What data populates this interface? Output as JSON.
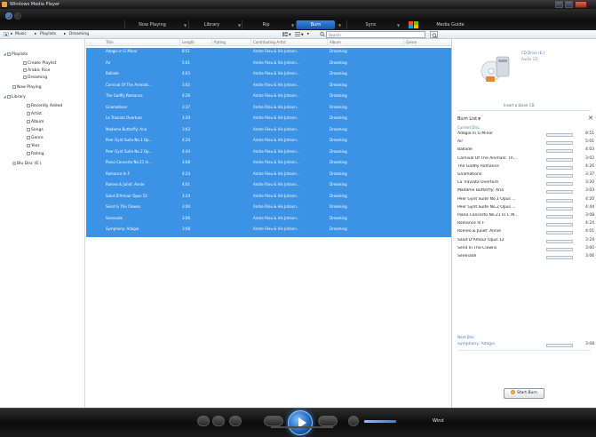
{
  "window": {
    "title": "Windows Media Player"
  },
  "nav": {
    "tabs": [
      {
        "label": "Now Playing"
      },
      {
        "label": "Library"
      },
      {
        "label": "Rip"
      },
      {
        "label": "Burn"
      },
      {
        "label": "Sync"
      },
      {
        "label": "Media Guide"
      }
    ],
    "active_tab": "Burn"
  },
  "address": {
    "breadcrumb": [
      "Music",
      "Playlists",
      "Dreaming"
    ],
    "search_placeholder": "Search"
  },
  "sidebar": {
    "items": [
      {
        "label": "Playlists",
        "level": 0,
        "expanded": true
      },
      {
        "label": "Create Playlist",
        "level": 1
      },
      {
        "label": "Arabic Rice",
        "level": 1
      },
      {
        "label": "Dreaming",
        "level": 1
      },
      {
        "label": "Now Playing",
        "level": 0
      },
      {
        "label": "Library",
        "level": 0,
        "expanded": true
      },
      {
        "label": "Recently Added",
        "level": 1
      },
      {
        "label": "Artist",
        "level": 1
      },
      {
        "label": "Album",
        "level": 1
      },
      {
        "label": "Songs",
        "level": 1
      },
      {
        "label": "Genre",
        "level": 1
      },
      {
        "label": "Year",
        "level": 1
      },
      {
        "label": "Rating",
        "level": 1
      },
      {
        "label": "Blu Disc (E:)",
        "level": 0
      }
    ]
  },
  "tracklist": {
    "columns": [
      "Title",
      "Length",
      "Rating",
      "Contributing Artist",
      "Album",
      "Genre"
    ],
    "rows": [
      {
        "title": "Adagio In G Minor",
        "length": "8:51",
        "rating": 3,
        "artist": "Andre Rieu & His Johann...",
        "album": "Dreaming"
      },
      {
        "title": "Air",
        "length": "5:01",
        "rating": 3,
        "artist": "Andre Rieu & His Johann...",
        "album": "Dreaming"
      },
      {
        "title": "Ballade",
        "length": "4:03",
        "rating": 3,
        "artist": "Andre Rieu & His Johann...",
        "album": "Dreaming"
      },
      {
        "title": "Carnival Of The Animals...",
        "length": "3:02",
        "rating": 3,
        "artist": "Andre Rieu & His Johann...",
        "album": "Dreaming"
      },
      {
        "title": "The Gadfly Romance",
        "length": "4:26",
        "rating": 4,
        "artist": "Andre Rieu & His Johann...",
        "album": "Dreaming"
      },
      {
        "title": "Gnamations",
        "length": "3:37",
        "rating": 4,
        "artist": "Andre Rieu & His Johann...",
        "album": "Dreaming"
      },
      {
        "title": "La Traviata Overture",
        "length": "3:20",
        "rating": 4,
        "artist": "Andre Rieu & His Johann...",
        "album": "Dreaming"
      },
      {
        "title": "Madame Butterfly: Aria",
        "length": "3:03",
        "rating": 4,
        "artist": "Andre Rieu & His Johann...",
        "album": "Dreaming"
      },
      {
        "title": "Peer Gynt Suite No.1 Op...",
        "length": "4:20",
        "rating": 4,
        "artist": "Andre Rieu & His Johann...",
        "album": "Dreaming"
      },
      {
        "title": "Peer Gynt Suite No.2 Op...",
        "length": "4:44",
        "rating": 4,
        "artist": "Andre Rieu & His Johann...",
        "album": "Dreaming"
      },
      {
        "title": "Piano Concerto No.21 In...",
        "length": "3:08",
        "rating": 4,
        "artist": "Andre Rieu & His Johann...",
        "album": "Dreaming"
      },
      {
        "title": "Romance In F",
        "length": "4:24",
        "rating": 4,
        "artist": "Andre Rieu & His Johann...",
        "album": "Dreaming"
      },
      {
        "title": "Romeo & Juliet: Annie",
        "length": "4:01",
        "rating": 4,
        "artist": "Andre Rieu & His Johann...",
        "album": "Dreaming"
      },
      {
        "title": "Salut D'Amour Opus 12",
        "length": "3:24",
        "rating": 4,
        "artist": "Andre Rieu & His Johann...",
        "album": "Dreaming"
      },
      {
        "title": "Send In The Clowns",
        "length": "3:00",
        "rating": 4,
        "artist": "Andre Rieu & His Johann...",
        "album": "Dreaming"
      },
      {
        "title": "Serenade",
        "length": "3:06",
        "rating": 4,
        "artist": "Andre Rieu & His Johann...",
        "album": "Dreaming"
      },
      {
        "title": "Symphony: Adagio",
        "length": "3:08",
        "rating": 4,
        "artist": "Andre Rieu & His Johann...",
        "album": "Dreaming"
      }
    ]
  },
  "burn": {
    "device_line1": "CD Drive (E:)",
    "device_line2": "Audio CD",
    "insert_text": "Insert a blank CD",
    "list_title": "Burn List",
    "disc_label": "Current Disc",
    "next_disc_label": "Next Disc",
    "tracks": [
      {
        "title": "Adagio In G Minor",
        "duration": "8:51"
      },
      {
        "title": "Air",
        "duration": "5:01"
      },
      {
        "title": "Ballade",
        "duration": "4:03"
      },
      {
        "title": "Carnival Of The Animals: Th...",
        "duration": "3:02"
      },
      {
        "title": "The Gadfly Romance",
        "duration": "4:26"
      },
      {
        "title": "Gnamations",
        "duration": "3:37"
      },
      {
        "title": "La Traviata Overture",
        "duration": "3:20"
      },
      {
        "title": "Madame Butterfly: Aria",
        "duration": "3:03"
      },
      {
        "title": "Peer Gynt Suite No.1 Opus ...",
        "duration": "4:20"
      },
      {
        "title": "Peer Gynt Suite No.2 Opus ...",
        "duration": "4:44"
      },
      {
        "title": "Piano Concerto No.21 In C M...",
        "duration": "3:08"
      },
      {
        "title": "Romance In F",
        "duration": "4:24"
      },
      {
        "title": "Romeo & Juliet: Annie",
        "duration": "4:01"
      },
      {
        "title": "Salut D'Amour Opus 12",
        "duration": "3:24"
      },
      {
        "title": "Send In The Clowns",
        "duration": "3:00"
      },
      {
        "title": "Serenade",
        "duration": "3:06"
      }
    ],
    "next_tracks": [
      {
        "title": "Symphony: Adagio",
        "duration": "3:08"
      }
    ],
    "start_burn_label": "Start Burn"
  },
  "player": {
    "mini_label": "Wind"
  },
  "colors": {
    "selection": "#3c93e6",
    "accent": "#1656a8",
    "link": "#4b7fc0"
  }
}
